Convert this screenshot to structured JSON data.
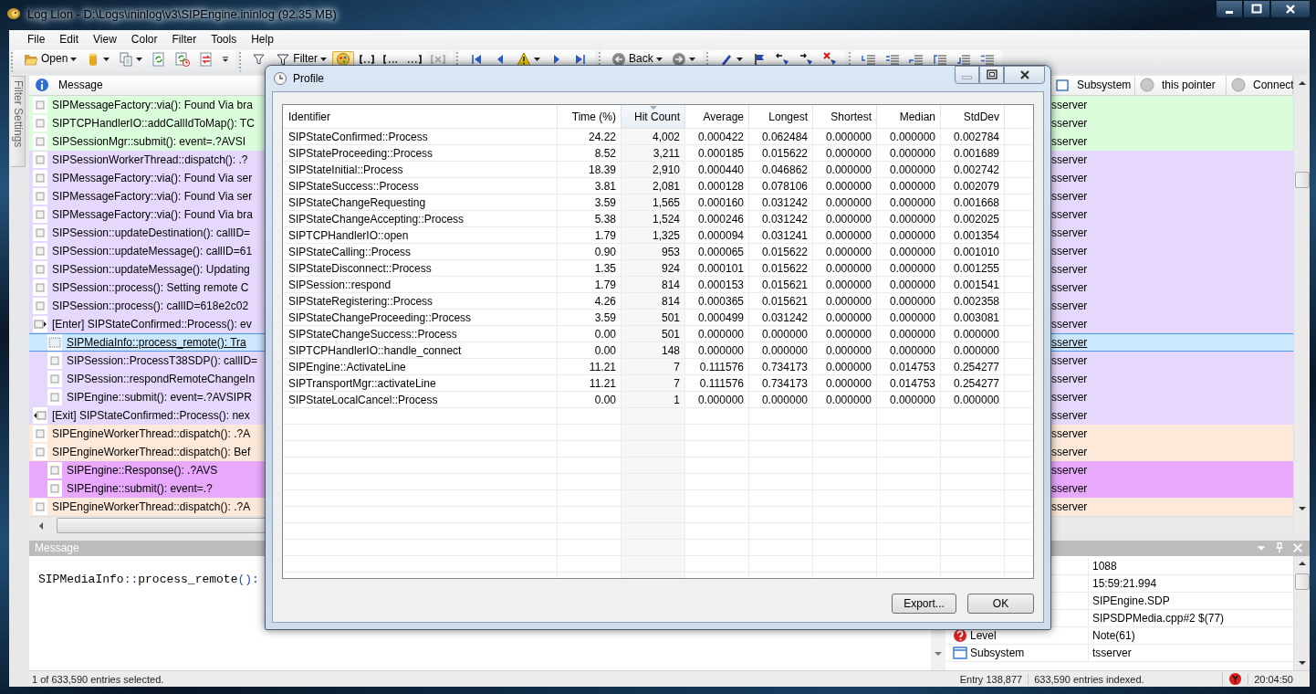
{
  "window": {
    "title": "Log Lion - D:\\Logs\\ininlog\\v3\\SIPEngine.ininlog (92.35 MB)"
  },
  "menu": [
    "File",
    "Edit",
    "View",
    "Color",
    "Filter",
    "Tools",
    "Help"
  ],
  "toolbar": [
    {
      "items": [
        {
          "kind": "open",
          "label": "Open",
          "dropdown": true,
          "pressed": false,
          "disabled": false
        },
        {
          "kind": "database",
          "dropdown": true,
          "pressed": false,
          "disabled": false
        },
        {
          "kind": "copy",
          "dropdown": true,
          "pressed": false,
          "disabled": false
        },
        {
          "kind": "reload",
          "dropdown": false,
          "pressed": false,
          "disabled": false
        },
        {
          "kind": "reload_time",
          "dropdown": false,
          "pressed": false,
          "disabled": false
        },
        {
          "kind": "reload_diff",
          "dropdown": false,
          "pressed": false,
          "disabled": false
        },
        {
          "kind": "overflow",
          "dropdown": false,
          "pressed": false,
          "disabled": false
        }
      ]
    },
    {
      "items": [
        {
          "kind": "filter_clear",
          "dropdown": false,
          "pressed": false,
          "disabled": false
        },
        {
          "kind": "filter",
          "label": "Filter",
          "dropdown": true,
          "pressed": false,
          "disabled": false
        },
        {
          "kind": "highlight",
          "dropdown": false,
          "pressed": true,
          "disabled": false
        },
        {
          "kind": "range_all",
          "dropdown": false,
          "pressed": false,
          "disabled": false
        },
        {
          "kind": "range_start",
          "dropdown": false,
          "pressed": false,
          "disabled": false
        },
        {
          "kind": "range_end",
          "dropdown": false,
          "pressed": false,
          "disabled": false
        },
        {
          "kind": "range_clear",
          "dropdown": false,
          "pressed": false,
          "disabled": true
        }
      ]
    },
    {
      "items": [
        {
          "kind": "first",
          "dropdown": false,
          "pressed": false,
          "disabled": false
        },
        {
          "kind": "prev",
          "dropdown": false,
          "pressed": false,
          "disabled": false
        },
        {
          "kind": "warning",
          "dropdown": true,
          "pressed": false,
          "disabled": false
        },
        {
          "kind": "next",
          "dropdown": false,
          "pressed": false,
          "disabled": false
        },
        {
          "kind": "last",
          "dropdown": false,
          "pressed": false,
          "disabled": false
        }
      ]
    },
    {
      "items": [
        {
          "kind": "back",
          "label": "Back",
          "dropdown": true,
          "pressed": false,
          "disabled": false
        },
        {
          "kind": "forward",
          "dropdown": true,
          "pressed": false,
          "disabled": false
        }
      ]
    },
    {
      "items": [
        {
          "kind": "mark",
          "dropdown": true,
          "pressed": false,
          "disabled": false
        },
        {
          "kind": "mark_set",
          "dropdown": false,
          "pressed": false,
          "disabled": false
        },
        {
          "kind": "mark_prev",
          "dropdown": false,
          "pressed": false,
          "disabled": false
        },
        {
          "kind": "mark_next",
          "dropdown": false,
          "pressed": false,
          "disabled": false
        },
        {
          "kind": "mark_clear",
          "dropdown": false,
          "pressed": false,
          "disabled": false
        }
      ]
    },
    {
      "items": [
        {
          "kind": "lines_a",
          "dropdown": false,
          "pressed": false,
          "disabled": false
        },
        {
          "kind": "lines_b",
          "dropdown": false,
          "pressed": false,
          "disabled": false
        },
        {
          "kind": "lines_c",
          "dropdown": false,
          "pressed": false,
          "disabled": false
        },
        {
          "kind": "lines_d",
          "dropdown": false,
          "pressed": false,
          "disabled": false
        },
        {
          "kind": "lines_e",
          "dropdown": false,
          "pressed": false,
          "disabled": false
        },
        {
          "kind": "lines_f",
          "dropdown": false,
          "pressed": false,
          "disabled": false
        }
      ]
    }
  ],
  "side_tab": "Filter Settings",
  "log": {
    "columns": [
      {
        "label": "Message",
        "kind": "info"
      },
      {
        "label": "Subsystem",
        "kind": "square"
      },
      {
        "label": "this pointer",
        "kind": "circle"
      },
      {
        "label": "Connect",
        "kind": "circle"
      }
    ],
    "rows": [
      {
        "kind": "entry",
        "message": "SIPMessageFactory::via(): Found Via bra",
        "subsystem": "sserver",
        "color": "#dcfddc",
        "selected": false
      },
      {
        "kind": "entry",
        "message": "SIPTCPHandlerIO::addCallIdToMap(): TC",
        "subsystem": "sserver",
        "color": "#dcfddc",
        "selected": false
      },
      {
        "kind": "entry",
        "message": "SIPSessionMgr::submit(): event=.?AVSI",
        "subsystem": "sserver",
        "color": "#dcfddc",
        "selected": false
      },
      {
        "kind": "entry",
        "message": "SIPSessionWorkerThread::dispatch(): .?",
        "subsystem": "sserver",
        "color": "#e6d8fc",
        "selected": false
      },
      {
        "kind": "entry",
        "message": "SIPMessageFactory::via(): Found Via ser",
        "subsystem": "sserver",
        "color": "#e6d8fc",
        "selected": false
      },
      {
        "kind": "entry",
        "message": "SIPMessageFactory::via(): Found Via ser",
        "subsystem": "sserver",
        "color": "#e6d8fc",
        "selected": false
      },
      {
        "kind": "entry",
        "message": "SIPMessageFactory::via(): Found Via bra",
        "subsystem": "sserver",
        "color": "#e6d8fc",
        "selected": false
      },
      {
        "kind": "entry",
        "message": "SIPSession::updateDestination(): callID=",
        "subsystem": "sserver",
        "color": "#e6d8fc",
        "selected": false
      },
      {
        "kind": "entry",
        "message": "SIPSession::updateMessage(): callID=61",
        "subsystem": "sserver",
        "color": "#e6d8fc",
        "selected": false
      },
      {
        "kind": "entry",
        "message": "SIPSession::updateMessage(): Updating",
        "subsystem": "sserver",
        "color": "#e6d8fc",
        "selected": false
      },
      {
        "kind": "entry",
        "message": "SIPSession::process(): Setting remote C",
        "subsystem": "sserver",
        "color": "#e6d8fc",
        "selected": false
      },
      {
        "kind": "entry",
        "message": "SIPSession::process(): callID=618e2c02",
        "subsystem": "sserver",
        "color": "#e6d8fc",
        "selected": false
      },
      {
        "kind": "enter",
        "message": "[Enter] SIPStateConfirmed::Process(): ev",
        "subsystem": "sserver",
        "color": "#e6d8fc",
        "selected": false,
        "children": [
          {
            "kind": "entry",
            "message": "SIPMediaInfo::process_remote(): Tra",
            "subsystem": "sserver",
            "selected": true
          },
          {
            "kind": "entry",
            "message": "SIPSession::ProcessT38SDP(): callID=",
            "subsystem": "sserver",
            "color": "#e6d8fc",
            "selected": false
          },
          {
            "kind": "entry",
            "message": "SIPSession::respondRemoteChangeIn",
            "subsystem": "sserver",
            "color": "#e6d8fc",
            "selected": false
          },
          {
            "kind": "entry",
            "message": "SIPEngine::submit(): event=.?AVSIPR",
            "subsystem": "sserver",
            "color": "#e6d8fc",
            "selected": false
          }
        ]
      },
      {
        "kind": "exit",
        "message": "[Exit] SIPStateConfirmed::Process(): nex",
        "subsystem": "sserver",
        "color": "#e6d8fc",
        "selected": false
      },
      {
        "kind": "entry",
        "message": "SIPEngineWorkerThread::dispatch(): .?A",
        "subsystem": "sserver",
        "color": "#fde9d9",
        "selected": false
      },
      {
        "kind": "entry",
        "message": "SIPEngineWorkerThread::dispatch(): Bef",
        "subsystem": "sserver",
        "color": "#fde9d9",
        "selected": false,
        "children": [
          {
            "kind": "entry",
            "message": "SIPEngine::Response(): .?AVS",
            "subsystem": "sserver",
            "color": "#e8a8fc",
            "selected": false
          },
          {
            "kind": "entry",
            "message": "SIPEngine::submit(): event=.?",
            "subsystem": "sserver",
            "color": "#e8a8fc",
            "selected": false
          }
        ]
      },
      {
        "kind": "entry",
        "message": "SIPEngineWorkerThread::dispatch(): .?A",
        "subsystem": "sserver",
        "color": "#fde9d9",
        "selected": false
      }
    ]
  },
  "message_panel": {
    "title": "Message",
    "tokens": [
      {
        "text": "SIPMediaInfo",
        "kind": "ident"
      },
      {
        "text": "::",
        "kind": "punct"
      },
      {
        "text": "process_remote",
        "kind": "ident"
      },
      {
        "text": "():",
        "kind": "punct"
      }
    ]
  },
  "properties": [
    {
      "kind": "plain",
      "value": "1088"
    },
    {
      "kind": "plain",
      "value": "15:59:21.994"
    },
    {
      "kind": "plain",
      "value": "SIPEngine.SDP"
    },
    {
      "kind": "plain",
      "value": "SIPSDPMedia.cpp#2 $(77)"
    },
    {
      "kind": "level",
      "name": "Level",
      "value": "Note(61)"
    },
    {
      "kind": "subsystem",
      "name": "Subsystem",
      "value": "tsserver"
    }
  ],
  "status_bar": {
    "selection": "1 of 633,590 entries selected.",
    "entry": "Entry 138,877",
    "indexed": "633,590 entries indexed.",
    "time": "20:04:50"
  },
  "profile": {
    "title": "Profile",
    "columns": [
      {
        "label": "Identifier",
        "sorted": false
      },
      {
        "label": "Time (%)",
        "sorted": false
      },
      {
        "label": "Hit Count",
        "sorted": true
      },
      {
        "label": "Average",
        "sorted": false
      },
      {
        "label": "Longest",
        "sorted": false
      },
      {
        "label": "Shortest",
        "sorted": false
      },
      {
        "label": "Median",
        "sorted": false
      },
      {
        "label": "StdDev",
        "sorted": false
      }
    ],
    "rows": [
      [
        "SIPStateConfirmed::Process",
        "24.22",
        "4,002",
        "0.000422",
        "0.062484",
        "0.000000",
        "0.000000",
        "0.002784"
      ],
      [
        "SIPStateProceeding::Process",
        "8.52",
        "3,211",
        "0.000185",
        "0.015622",
        "0.000000",
        "0.000000",
        "0.001689"
      ],
      [
        "SIPStateInitial::Process",
        "18.39",
        "2,910",
        "0.000440",
        "0.046862",
        "0.000000",
        "0.000000",
        "0.002742"
      ],
      [
        "SIPStateSuccess::Process",
        "3.81",
        "2,081",
        "0.000128",
        "0.078106",
        "0.000000",
        "0.000000",
        "0.002079"
      ],
      [
        "SIPStateChangeRequesting",
        "3.59",
        "1,565",
        "0.000160",
        "0.031242",
        "0.000000",
        "0.000000",
        "0.001668"
      ],
      [
        "SIPStateChangeAccepting::Process",
        "5.38",
        "1,524",
        "0.000246",
        "0.031242",
        "0.000000",
        "0.000000",
        "0.002025"
      ],
      [
        "SIPTCPHandlerIO::open",
        "1.79",
        "1,325",
        "0.000094",
        "0.031241",
        "0.000000",
        "0.000000",
        "0.001354"
      ],
      [
        "SIPStateCalling::Process",
        "0.90",
        "953",
        "0.000065",
        "0.015622",
        "0.000000",
        "0.000000",
        "0.001010"
      ],
      [
        "SIPStateDisconnect::Process",
        "1.35",
        "924",
        "0.000101",
        "0.015622",
        "0.000000",
        "0.000000",
        "0.001255"
      ],
      [
        "SIPSession::respond",
        "1.79",
        "814",
        "0.000153",
        "0.015621",
        "0.000000",
        "0.000000",
        "0.001541"
      ],
      [
        "SIPStateRegistering::Process",
        "4.26",
        "814",
        "0.000365",
        "0.015621",
        "0.000000",
        "0.000000",
        "0.002358"
      ],
      [
        "SIPStateChangeProceeding::Process",
        "3.59",
        "501",
        "0.000499",
        "0.031242",
        "0.000000",
        "0.000000",
        "0.003081"
      ],
      [
        "SIPStateChangeSuccess::Process",
        "0.00",
        "501",
        "0.000000",
        "0.000000",
        "0.000000",
        "0.000000",
        "0.000000"
      ],
      [
        "SIPTCPHandlerIO::handle_connect",
        "0.00",
        "148",
        "0.000000",
        "0.000000",
        "0.000000",
        "0.000000",
        "0.000000"
      ],
      [
        "SIPEngine::ActivateLine",
        "11.21",
        "7",
        "0.111576",
        "0.734173",
        "0.000000",
        "0.014753",
        "0.254277"
      ],
      [
        "SIPTransportMgr::activateLine",
        "11.21",
        "7",
        "0.111576",
        "0.734173",
        "0.000000",
        "0.014753",
        "0.254277"
      ],
      [
        "SIPStateLocalCancel::Process",
        "0.00",
        "1",
        "0.000000",
        "0.000000",
        "0.000000",
        "0.000000",
        "0.000000"
      ]
    ],
    "buttons": [
      "Export...",
      "OK"
    ]
  }
}
